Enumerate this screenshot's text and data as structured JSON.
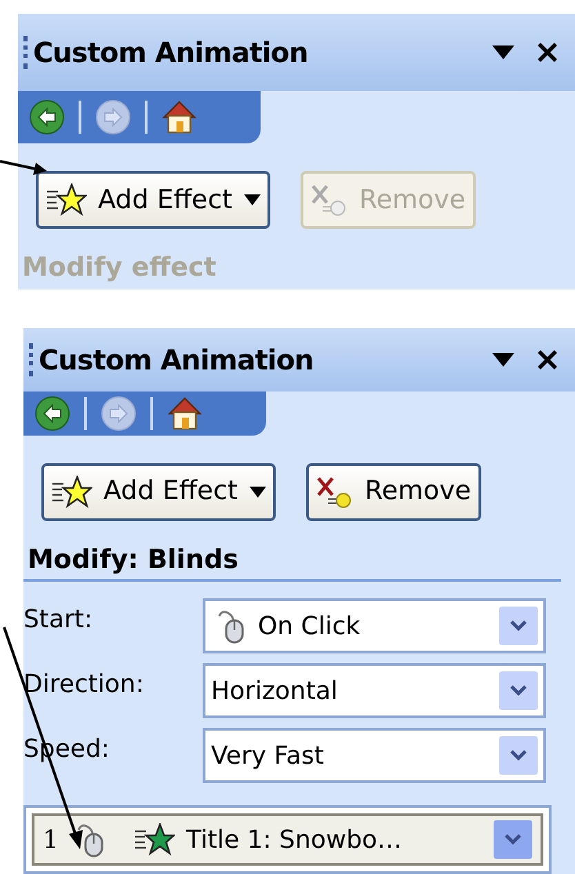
{
  "panels": [
    {
      "title": "Custom Animation",
      "nav": [
        {
          "kind": "back",
          "disabled": false
        },
        {
          "kind": "forward",
          "disabled": true
        },
        {
          "kind": "home",
          "disabled": false
        }
      ],
      "buttons": [
        {
          "kind": "add",
          "label": "Add Effect",
          "disabled": false
        },
        {
          "kind": "remove",
          "label": "Remove",
          "disabled": true
        }
      ],
      "section_heading": {
        "text": "Modify effect",
        "disabled": true
      }
    },
    {
      "title": "Custom Animation",
      "nav": [
        {
          "kind": "back",
          "disabled": false
        },
        {
          "kind": "forward",
          "disabled": true
        },
        {
          "kind": "home",
          "disabled": false
        }
      ],
      "buttons": [
        {
          "kind": "add",
          "label": "Add Effect",
          "disabled": false
        },
        {
          "kind": "remove",
          "label": "Remove",
          "disabled": false
        }
      ],
      "section_heading": {
        "text": "Modify: Blinds",
        "disabled": false
      },
      "fields": [
        {
          "label": "Start:",
          "value": "On Click",
          "kind": "mouse"
        },
        {
          "label": "Direction:",
          "value": "Horizontal",
          "kind": "plain"
        },
        {
          "label": "Speed:",
          "value": "Very Fast",
          "kind": "plain"
        }
      ],
      "list_items": [
        {
          "number": "1",
          "text": "Title 1: Snowbo…",
          "selected": true
        }
      ]
    }
  ]
}
